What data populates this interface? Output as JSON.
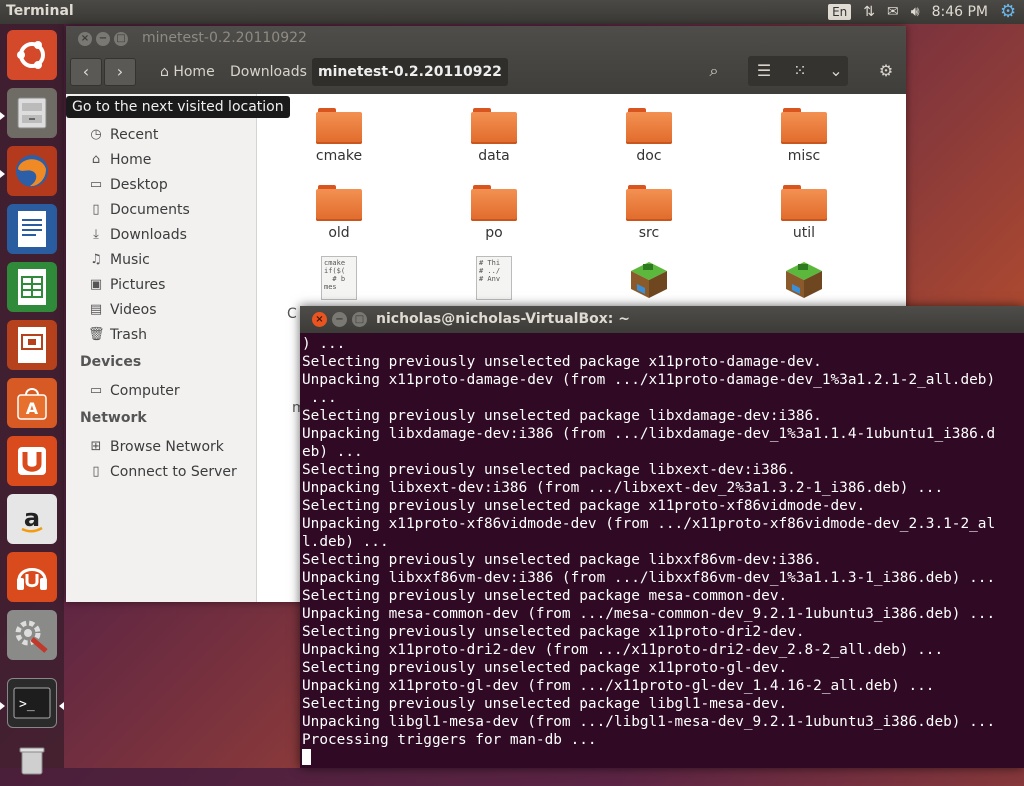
{
  "top_panel": {
    "app_title": "Terminal",
    "keyboard_layout": "En",
    "clock": "8:46 PM"
  },
  "launcher": {
    "items": [
      {
        "name": "dash-home",
        "icon": "ubuntu-logo-icon"
      },
      {
        "name": "files",
        "icon": "file-cabinet-icon"
      },
      {
        "name": "firefox",
        "icon": "firefox-icon"
      },
      {
        "name": "libreoffice-writer",
        "icon": "writer-icon"
      },
      {
        "name": "libreoffice-calc",
        "icon": "calc-icon"
      },
      {
        "name": "libreoffice-impress",
        "icon": "impress-icon"
      },
      {
        "name": "software-center",
        "icon": "software-center-icon"
      },
      {
        "name": "ubuntu-one",
        "icon": "ubuntu-one-icon"
      },
      {
        "name": "amazon",
        "icon": "amazon-icon"
      },
      {
        "name": "ubuntu-one-music",
        "icon": "ubuntu-one-music-icon"
      },
      {
        "name": "system-settings",
        "icon": "settings-icon"
      },
      {
        "name": "terminal",
        "icon": "terminal-icon"
      },
      {
        "name": "trash",
        "icon": "trash-icon"
      }
    ]
  },
  "file_manager": {
    "title": "minetest-0.2.20110922",
    "breadcrumbs": [
      "Home",
      "Downloads",
      "minetest-0.2.20110922"
    ],
    "tooltip": "Go to the next visited location",
    "sidebar": {
      "places": [
        {
          "label": "Recent",
          "icon": "clock-icon"
        },
        {
          "label": "Home",
          "icon": "home-icon"
        },
        {
          "label": "Desktop",
          "icon": "desktop-icon"
        },
        {
          "label": "Documents",
          "icon": "documents-icon"
        },
        {
          "label": "Downloads",
          "icon": "download-icon"
        },
        {
          "label": "Music",
          "icon": "music-icon"
        },
        {
          "label": "Pictures",
          "icon": "pictures-icon"
        },
        {
          "label": "Videos",
          "icon": "videos-icon"
        },
        {
          "label": "Trash",
          "icon": "trash-icon"
        }
      ],
      "devices_heading": "Devices",
      "devices": [
        {
          "label": "Computer",
          "icon": "computer-icon"
        }
      ],
      "network_heading": "Network",
      "network": [
        {
          "label": "Browse Network",
          "icon": "network-icon"
        },
        {
          "label": "Connect to Server",
          "icon": "server-icon"
        }
      ]
    },
    "items": [
      {
        "name": "cmake",
        "type": "folder"
      },
      {
        "name": "data",
        "type": "folder"
      },
      {
        "name": "doc",
        "type": "folder"
      },
      {
        "name": "misc",
        "type": "folder"
      },
      {
        "name": "old",
        "type": "folder"
      },
      {
        "name": "po",
        "type": "folder"
      },
      {
        "name": "src",
        "type": "folder"
      },
      {
        "name": "util",
        "type": "folder"
      },
      {
        "name": "",
        "type": "text",
        "preview": "cmake\nif($(\n  # b\nmes"
      },
      {
        "name": "",
        "type": "text",
        "preview": "# Thi\n# ../\n# Anv"
      },
      {
        "name": "",
        "type": "minetest-cube"
      },
      {
        "name": "",
        "type": "minetest-cube"
      }
    ],
    "partial_labels": {
      "left_c": "C",
      "left_m": "m"
    }
  },
  "terminal": {
    "title": "nicholas@nicholas-VirtualBox: ~",
    "lines": [
      ") ...",
      "Selecting previously unselected package x11proto-damage-dev.",
      "Unpacking x11proto-damage-dev (from .../x11proto-damage-dev_1%3a1.2.1-2_all.deb)",
      " ...",
      "Selecting previously unselected package libxdamage-dev:i386.",
      "Unpacking libxdamage-dev:i386 (from .../libxdamage-dev_1%3a1.1.4-1ubuntu1_i386.d",
      "eb) ...",
      "Selecting previously unselected package libxext-dev:i386.",
      "Unpacking libxext-dev:i386 (from .../libxext-dev_2%3a1.3.2-1_i386.deb) ...",
      "Selecting previously unselected package x11proto-xf86vidmode-dev.",
      "Unpacking x11proto-xf86vidmode-dev (from .../x11proto-xf86vidmode-dev_2.3.1-2_al",
      "l.deb) ...",
      "Selecting previously unselected package libxxf86vm-dev:i386.",
      "Unpacking libxxf86vm-dev:i386 (from .../libxxf86vm-dev_1%3a1.1.3-1_i386.deb) ...",
      "Selecting previously unselected package mesa-common-dev.",
      "Unpacking mesa-common-dev (from .../mesa-common-dev_9.2.1-1ubuntu3_i386.deb) ...",
      "Selecting previously unselected package x11proto-dri2-dev.",
      "Unpacking x11proto-dri2-dev (from .../x11proto-dri2-dev_2.8-2_all.deb) ...",
      "Selecting previously unselected package x11proto-gl-dev.",
      "Unpacking x11proto-gl-dev (from .../x11proto-gl-dev_1.4.16-2_all.deb) ...",
      "Selecting previously unselected package libgl1-mesa-dev.",
      "Unpacking libgl1-mesa-dev (from .../libgl1-mesa-dev_9.2.1-1ubuntu3_i386.deb) ...",
      "Processing triggers for man-db ..."
    ]
  },
  "colors": {
    "terminal_bg": "#300a24",
    "folder_orange": "#e8702f",
    "close_button": "#e95420"
  }
}
